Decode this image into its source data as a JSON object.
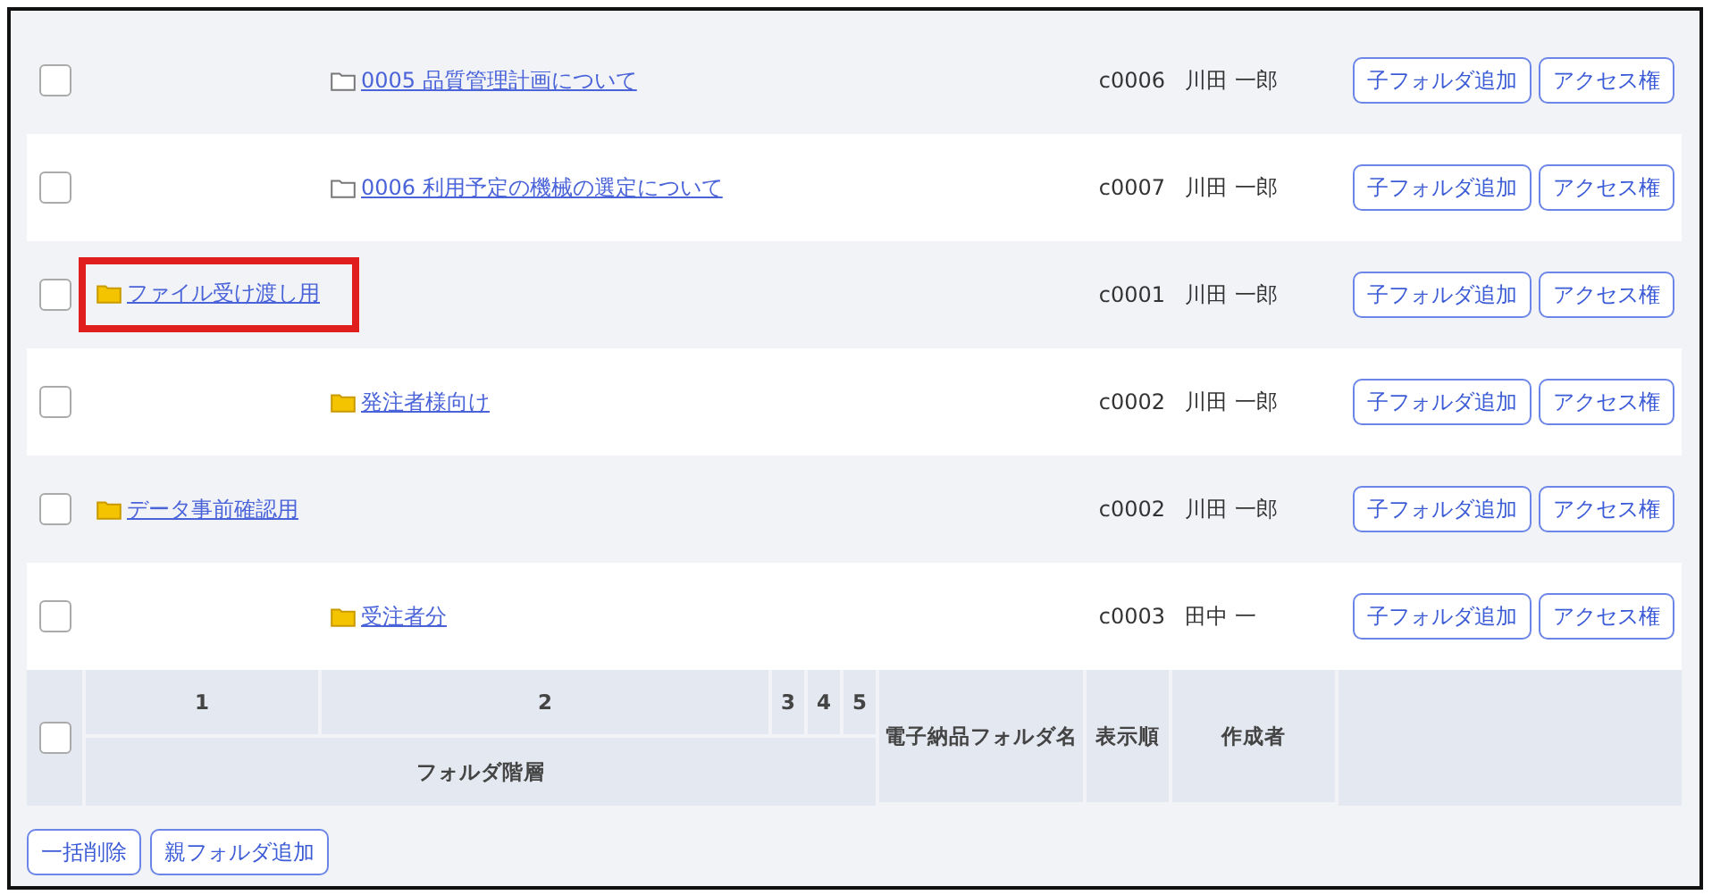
{
  "rows": [
    {
      "children": [
        {
          "name": "0005 品質管理計画について",
          "kind": "outline",
          "checked": false,
          "highlighted": false,
          "order": "c0006",
          "creator": "川田 一郎",
          "actions": [
            "子フォルダ追加",
            "アクセス権"
          ]
        },
        {
          "name": "0006 利用予定の機械の選定について",
          "kind": "outline",
          "checked": false,
          "highlighted": false,
          "order": "c0007",
          "creator": "川田 一郎",
          "actions": [
            "子フォルダ追加",
            "アクセス権"
          ]
        }
      ]
    },
    {
      "name": "ファイル受け渡し用",
      "kind": "filled",
      "checked": false,
      "highlighted": true,
      "order": "c0001",
      "creator": "川田 一郎",
      "actions": [
        "子フォルダ追加",
        "アクセス権"
      ],
      "children": [
        {
          "name": "発注者様向け",
          "kind": "filled",
          "checked": false,
          "highlighted": false,
          "order": "c0002",
          "creator": "川田 一郎",
          "actions": [
            "子フォルダ追加",
            "アクセス権"
          ]
        }
      ]
    },
    {
      "name": "データ事前確認用",
      "kind": "filled",
      "checked": false,
      "highlighted": false,
      "order": "c0002",
      "creator": "川田 一郎",
      "actions": [
        "子フォルダ追加",
        "アクセス権"
      ],
      "children": [
        {
          "name": "受注者分",
          "kind": "filled",
          "checked": false,
          "highlighted": false,
          "order": "c0003",
          "creator": "田中 一",
          "actions": [
            "子フォルダ追加",
            "アクセス権"
          ]
        }
      ]
    }
  ],
  "header": {
    "checked": false,
    "levels": [
      "1",
      "2",
      "3",
      "4",
      "5"
    ],
    "level_group": "フォルダ階層",
    "columns": [
      "電子納品フォルダ名",
      "表示順",
      "作成者"
    ]
  },
  "footer_buttons": [
    "一括削除",
    "親フォルダ追加"
  ]
}
